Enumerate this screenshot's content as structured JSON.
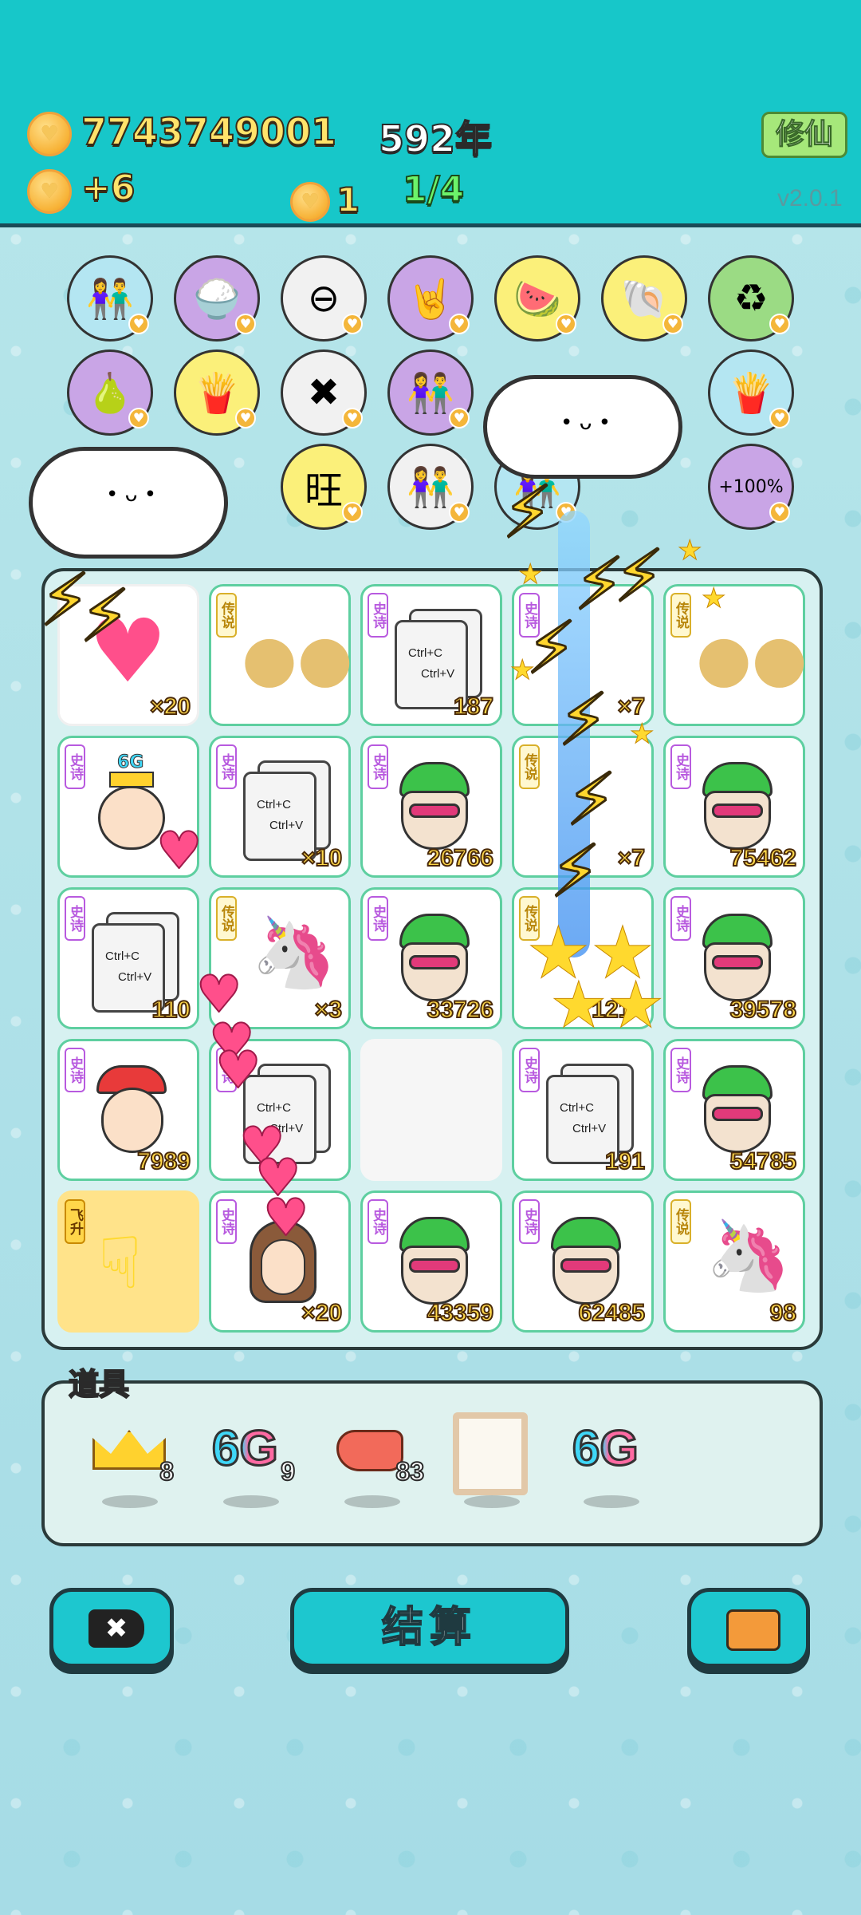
{
  "header": {
    "coins": "7743749001",
    "year": "592年",
    "income": "+6",
    "coin_small": "1",
    "progress": "1/4",
    "xiuxian_label": "修仙",
    "version": "v2.0.1"
  },
  "icons": [
    {
      "name": "lovers-icon",
      "glyph": "👫",
      "bg": "blue"
    },
    {
      "name": "rice-bowl-icon",
      "glyph": "🍚",
      "bg": "purple"
    },
    {
      "name": "minus-icon",
      "glyph": "⊖",
      "bg": "white"
    },
    {
      "name": "rock-hand-icon",
      "glyph": "🤘",
      "bg": "purple"
    },
    {
      "name": "fruit-basket-icon",
      "glyph": "🍉",
      "bg": "yellow"
    },
    {
      "name": "shell-icon",
      "glyph": "🐚",
      "bg": "yellow"
    },
    {
      "name": "recycle-icon",
      "glyph": "♻",
      "bg": "green"
    },
    {
      "name": "grapefruit-icon",
      "glyph": "🍐",
      "bg": "purple"
    },
    {
      "name": "fries-icon",
      "glyph": "🍟",
      "bg": "yellow"
    },
    {
      "name": "delete-tag-icon",
      "glyph": "✖",
      "bg": "white"
    },
    {
      "name": "lovers-icon",
      "glyph": "👫",
      "bg": "purple"
    },
    {
      "name": "fries-icon",
      "glyph": "🍟",
      "bg": "blue"
    },
    {
      "name": "lovers-icon",
      "glyph": "👫",
      "bg": "white"
    },
    {
      "name": "wang-icon",
      "glyph": "旺",
      "bg": "yellow"
    },
    {
      "name": "lovers-icon",
      "glyph": "👫",
      "bg": "blue"
    },
    {
      "name": "cup-icon",
      "glyph": "+100%",
      "bg": "purple"
    }
  ],
  "board": {
    "tiles": [
      {
        "name": "heart-tile",
        "tag": "",
        "count": "×20",
        "kind": "heart"
      },
      {
        "name": "fruit-tile",
        "tag": "传说",
        "count": "",
        "kind": "fruit"
      },
      {
        "name": "copy-tile",
        "tag": "史诗",
        "count": "187",
        "kind": "copy"
      },
      {
        "name": "effect-tile",
        "tag": "史诗",
        "count": "×7",
        "kind": "empty"
      },
      {
        "name": "fruit-tile",
        "tag": "传说",
        "count": "",
        "kind": "fruit"
      },
      {
        "name": "old-man-tile",
        "tag": "史诗",
        "count": "",
        "kind": "oldman"
      },
      {
        "name": "copy-tile",
        "tag": "史诗",
        "count": "×10",
        "kind": "copy"
      },
      {
        "name": "green-hat-tile",
        "tag": "史诗",
        "count": "26766",
        "kind": "greenhat"
      },
      {
        "name": "effect-tile",
        "tag": "传说",
        "count": "×7",
        "kind": "empty"
      },
      {
        "name": "green-hat-tile",
        "tag": "史诗",
        "count": "75462",
        "kind": "greenhat"
      },
      {
        "name": "copy-tile",
        "tag": "史诗",
        "count": "110",
        "kind": "copy"
      },
      {
        "name": "unicorn-tile",
        "tag": "传说",
        "count": "×3",
        "kind": "unicorn"
      },
      {
        "name": "green-hat-tile",
        "tag": "史诗",
        "count": "33726",
        "kind": "greenhat"
      },
      {
        "name": "effect-tile",
        "tag": "传说",
        "count": "1214",
        "kind": "empty"
      },
      {
        "name": "green-hat-tile",
        "tag": "史诗",
        "count": "39578",
        "kind": "greenhat"
      },
      {
        "name": "red-hat-tile",
        "tag": "史诗",
        "count": "7989",
        "kind": "redhat"
      },
      {
        "name": "copy-tile",
        "tag": "史诗",
        "count": "",
        "kind": "copy"
      },
      {
        "name": "empty-tile",
        "tag": "",
        "count": "",
        "kind": "blank"
      },
      {
        "name": "copy-tile",
        "tag": "史诗",
        "count": "191",
        "kind": "copy"
      },
      {
        "name": "green-hat-tile",
        "tag": "史诗",
        "count": "54785",
        "kind": "greenhat"
      },
      {
        "name": "fly-up-tile",
        "tag": "飞升",
        "count": "",
        "kind": "fly"
      },
      {
        "name": "girl-tile",
        "tag": "史诗",
        "count": "×20",
        "kind": "girl"
      },
      {
        "name": "green-hat-tile",
        "tag": "史诗",
        "count": "43359",
        "kind": "greenhat"
      },
      {
        "name": "green-hat-tile",
        "tag": "史诗",
        "count": "62485",
        "kind": "greenhat"
      },
      {
        "name": "unicorn-tile",
        "tag": "传说",
        "count": "98",
        "kind": "unicorn"
      }
    ],
    "copy_line1": "Ctrl+C",
    "copy_line2": "Ctrl+V",
    "sixg_badge": "6G"
  },
  "props": {
    "title": "道具",
    "items": [
      {
        "name": "crown-prop",
        "label": "👑",
        "num": "8"
      },
      {
        "name": "sixg-prop",
        "label": "6G",
        "num": "9"
      },
      {
        "name": "liver-prop",
        "label": "🫁",
        "num": "83"
      },
      {
        "name": "frame-prop",
        "label": "",
        "num": ""
      },
      {
        "name": "sixg-prop",
        "label": "6G",
        "num": ""
      }
    ]
  },
  "buttons": {
    "settle_label": "结算"
  },
  "colors": {
    "header_bg": "#17c7c9",
    "button_bg": "#1dc7cf",
    "epic_tag": "#b85adf",
    "legend_tag": "#d9b02a"
  }
}
